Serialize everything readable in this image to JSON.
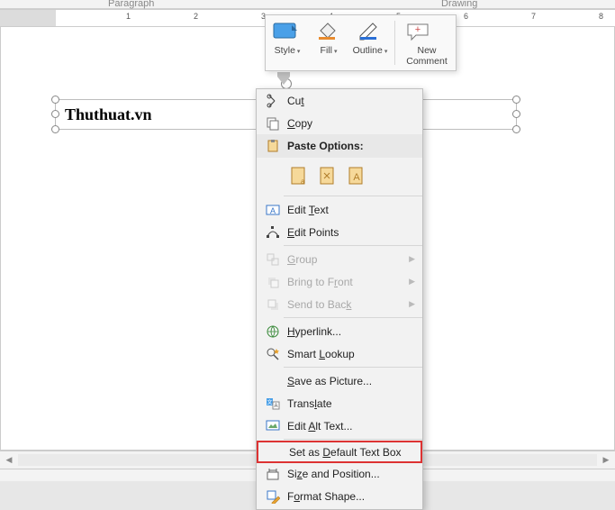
{
  "ribbon": {
    "groups": {
      "paragraph": "Paragraph",
      "drawing": "Drawing"
    }
  },
  "mini": {
    "style": "Style",
    "fill": "Fill",
    "outline": "Outline",
    "comment": "New Comment"
  },
  "textbox": {
    "content": "Thuthuat.vn"
  },
  "ctx": {
    "cut": "Cut",
    "copy": "Copy",
    "paste_header": "Paste Options:",
    "edit_text": "Edit Text",
    "edit_points": "Edit Points",
    "group": "Group",
    "bring_front": "Bring to Front",
    "send_back": "Send to Back",
    "hyperlink": "Hyperlink...",
    "smart_lookup": "Smart Lookup",
    "save_picture": "Save as Picture...",
    "translate": "Translate",
    "edit_alt": "Edit Alt Text...",
    "set_default": "Set as Default Text Box",
    "size_pos": "Size and Position...",
    "format_shape": "Format Shape..."
  },
  "accel": {
    "cut": "t",
    "copy": "C",
    "edit_text": "T",
    "edit_points": "E",
    "group": "G",
    "bring_front": "R",
    "send_back": "K",
    "hyperlink": "H",
    "smart_lookup": "L",
    "save_picture": "S",
    "translate": "l",
    "edit_alt": "A",
    "set_default": "D",
    "size_pos": "z",
    "format_shape": "O"
  }
}
